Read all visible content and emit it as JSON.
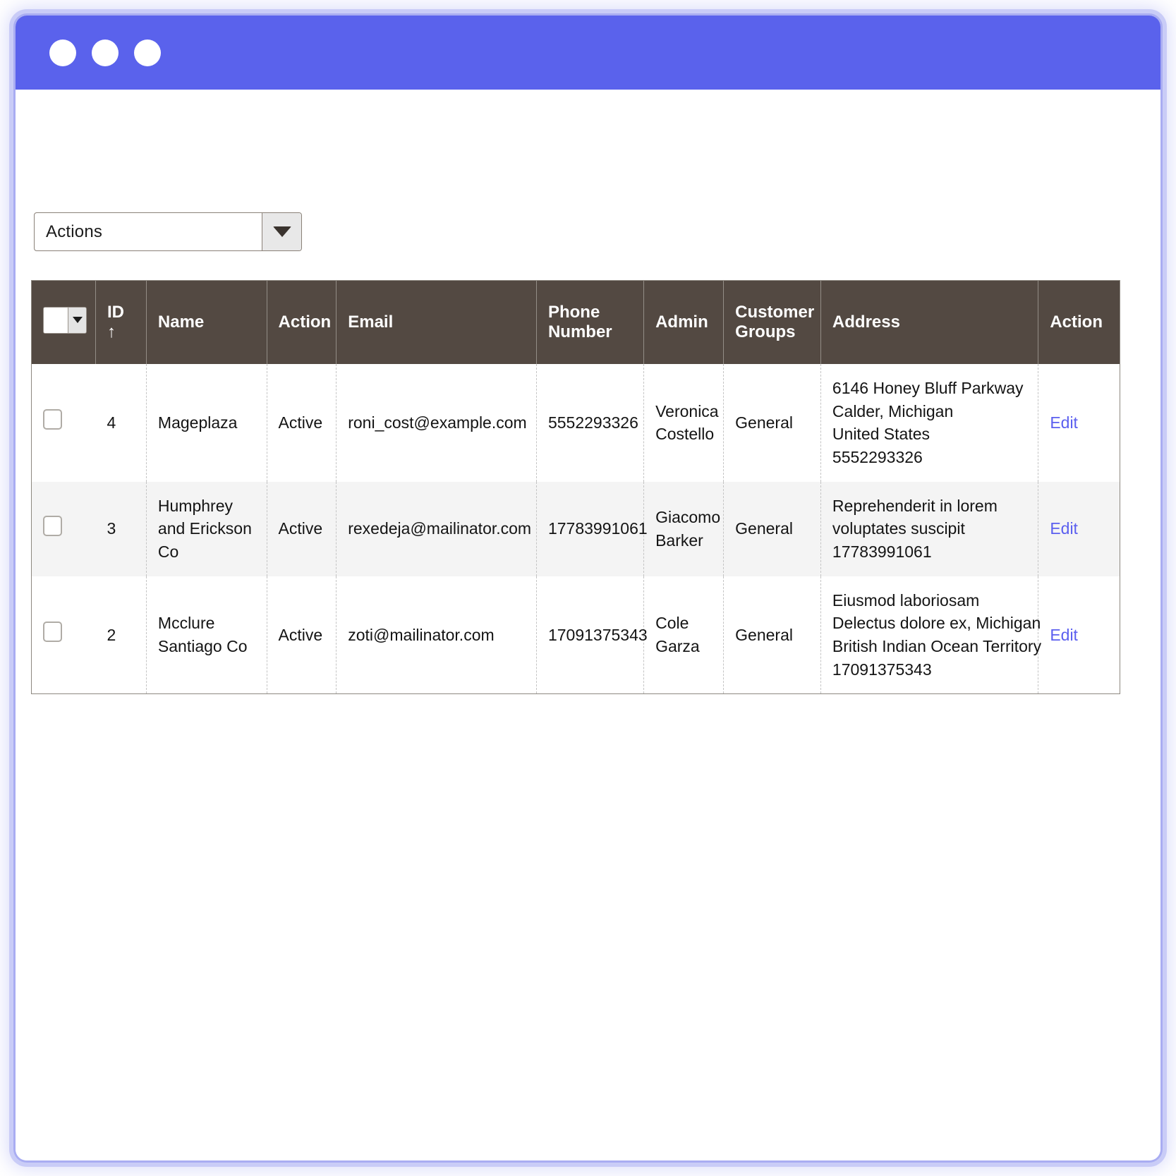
{
  "window": {
    "titlebar_color": "#5a62ec",
    "dots": [
      "dot-1",
      "dot-2",
      "dot-3"
    ]
  },
  "toolbar": {
    "actions_select_label": "Actions",
    "actions_caret_icon": "chevron-down-icon"
  },
  "table": {
    "header_bg": "#534942",
    "link_color": "#5b5fef",
    "select_all_caret_icon": "chevron-down-icon",
    "columns": [
      {
        "key": "check",
        "label": ""
      },
      {
        "key": "id",
        "label": "ID",
        "sort_indicator": "↑"
      },
      {
        "key": "name",
        "label": "Name"
      },
      {
        "key": "status",
        "label": "Action"
      },
      {
        "key": "email",
        "label": "Email"
      },
      {
        "key": "phone",
        "label": "Phone Number"
      },
      {
        "key": "admin",
        "label": "Admin"
      },
      {
        "key": "groups",
        "label": "Customer Groups"
      },
      {
        "key": "address",
        "label": "Address"
      },
      {
        "key": "action",
        "label": "Action"
      }
    ],
    "rows": [
      {
        "id": "4",
        "name": "Mageplaza",
        "status": "Active",
        "email": "roni_cost@example.com",
        "phone": "5552293326",
        "admin": "Veronica Costello",
        "groups": "General",
        "address": [
          "6146 Honey Bluff Parkway",
          "Calder, Michigan",
          "United States",
          "5552293326"
        ],
        "action": "Edit",
        "checked": false
      },
      {
        "id": "3",
        "name": "Humphrey and Erickson Co",
        "status": "Active",
        "email": "rexedeja@mailinator.com",
        "phone": "17783991061",
        "admin": "Giacomo Barker",
        "groups": "General",
        "address": [
          "Reprehenderit in lorem",
          "voluptates suscipit",
          "17783991061"
        ],
        "action": "Edit",
        "checked": false
      },
      {
        "id": "2",
        "name": "Mcclure Santiago Co",
        "status": "Active",
        "email": "zoti@mailinator.com",
        "phone": "17091375343",
        "admin": "Cole Garza",
        "groups": "General",
        "address": [
          "Eiusmod laboriosam",
          "Delectus dolore ex, Michigan",
          "British Indian Ocean Territory",
          "17091375343"
        ],
        "action": "Edit",
        "checked": false
      }
    ]
  }
}
